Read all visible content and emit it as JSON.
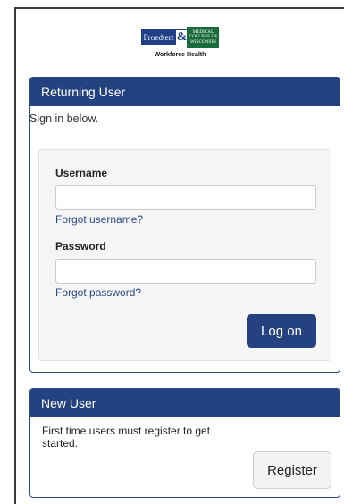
{
  "logo": {
    "left": "Froedtert",
    "amp": "&",
    "right_lines": [
      "Medical",
      "College of",
      "Wisconsin"
    ],
    "subtitle": "Workforce Health"
  },
  "returning": {
    "title": "Returning User",
    "intro": "Sign in below.",
    "username_label": "Username",
    "username_value": "",
    "forgot_username": "Forgot username?",
    "password_label": "Password",
    "password_value": "",
    "forgot_password": "Forgot password?",
    "logon_label": "Log on"
  },
  "newuser": {
    "title": "New User",
    "text": "First time users must register to get started.",
    "register_label": "Register"
  },
  "colors": {
    "brand_blue": "#24427f",
    "logo_green": "#1a6b3a",
    "link": "#2a4a86"
  }
}
